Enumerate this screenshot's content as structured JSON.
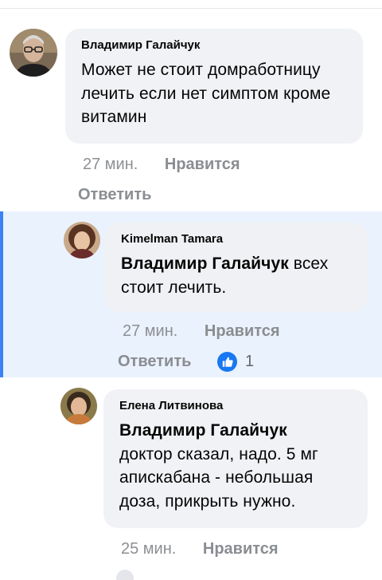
{
  "comments": [
    {
      "author": "Владимир Галайчук",
      "mention": "",
      "text": "Может не стоит домработницу лечить если нет симптом кроме витамин",
      "time": "27 мин.",
      "like_label": "Нравится",
      "reply_label": "Ответить",
      "avatar_icon": "user-avatar-man-glasses"
    },
    {
      "author": "Kimelman Tamara",
      "mention": "Владимир Галайчук",
      "text": "всех стоит лечить.",
      "time": "27 мин.",
      "like_label": "Нравится",
      "reply_label": "Ответить",
      "reaction_icon": "thumbs-up-icon",
      "reaction_count": "1",
      "avatar_icon": "user-avatar-woman-curly"
    },
    {
      "author": "Елена Литвинова",
      "mention": "Владимир Галайчук",
      "text": "доктор сказал, надо. 5 мг апискабана - небольшая доза, прикрыть нужно.",
      "time": "25 мин.",
      "like_label": "Нравится",
      "avatar_icon": "user-avatar-woman"
    }
  ],
  "colors": {
    "highlight_background": "#eaf2fd",
    "highlight_bar": "#3b82f6",
    "bubble": "#f0f2f5",
    "meta_text": "#8a8d91",
    "like_blue": "#1877f2"
  }
}
